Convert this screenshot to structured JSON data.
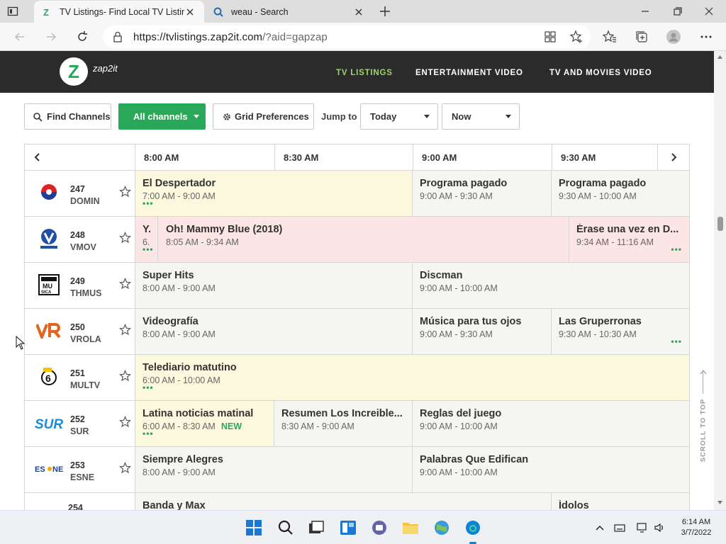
{
  "browser": {
    "tabs": [
      {
        "title": "TV Listings- Find Local TV Listing",
        "active": true
      },
      {
        "title": "weau - Search",
        "active": false
      }
    ],
    "url_host": "https://tvlistings.zap2it.com",
    "url_path": "/?aid=gapzap"
  },
  "site": {
    "logo_letter": "Z",
    "logo_text": "zap2it",
    "nav": [
      {
        "label": "TV LISTINGS",
        "active": true
      },
      {
        "label": "ENTERTAINMENT VIDEO",
        "active": false
      },
      {
        "label": "TV AND MOVIES VIDEO",
        "active": false
      }
    ]
  },
  "controls": {
    "find_channels": "Find Channels",
    "all_channels": "All channels",
    "grid_prefs": "Grid Preferences",
    "jump_to": "Jump to",
    "day": "Today",
    "time": "Now"
  },
  "grid": {
    "times": [
      "8:00 AM",
      "8:30 AM",
      "9:00 AM",
      "9:30 AM"
    ],
    "rows": [
      {
        "num": "247",
        "call": "DOMIN",
        "logo": "domin-logo",
        "programs": [
          {
            "title": "El Despertador",
            "time": "7:00 AM - 9:00 AM",
            "style": "live",
            "dots": "left"
          },
          {
            "title": "Programa pagado",
            "time": "9:00 AM - 9:30 AM",
            "style": "plain"
          },
          {
            "title": "Programa pagado",
            "time": "9:30 AM - 10:00 AM",
            "style": "plain"
          }
        ]
      },
      {
        "num": "248",
        "call": "VMOV",
        "logo": "vmov-logo",
        "programs": [
          {
            "title": "Y.",
            "time": "6.",
            "style": "movie",
            "dots": "left"
          },
          {
            "title": "Oh! Mammy Blue (2018)",
            "time": "8:05 AM - 9:34 AM",
            "style": "movie"
          },
          {
            "title": "Érase una vez en D...",
            "time": "9:34 AM - 11:16 AM",
            "style": "movie",
            "dots": "right"
          }
        ]
      },
      {
        "num": "249",
        "call": "THMUS",
        "logo": "thmus-logo",
        "programs": [
          {
            "title": "Super Hits",
            "time": "8:00 AM - 9:00 AM",
            "style": "plain"
          },
          {
            "title": "Discman",
            "time": "9:00 AM - 10:00 AM",
            "style": "plain"
          }
        ]
      },
      {
        "num": "250",
        "call": "VROLA",
        "logo": "vrola-logo",
        "programs": [
          {
            "title": "Videografía",
            "time": "8:00 AM - 9:00 AM",
            "style": "plain"
          },
          {
            "title": "Música para tus ojos",
            "time": "9:00 AM - 9:30 AM",
            "style": "plain"
          },
          {
            "title": "Las Gruperronas",
            "time": "9:30 AM - 10:30 AM",
            "style": "plain",
            "dots": "right"
          }
        ]
      },
      {
        "num": "251",
        "call": "MULTV",
        "logo": "multv-logo",
        "programs": [
          {
            "title": "Telediario matutino",
            "time": "6:00 AM - 10:00 AM",
            "style": "live",
            "dots": "left"
          }
        ]
      },
      {
        "num": "252",
        "call": "SUR",
        "logo": "sur-logo",
        "programs": [
          {
            "title": "Latina noticias matinal",
            "time": "6:00 AM - 8:30 AM",
            "badge": "NEW",
            "style": "live",
            "dots": "left"
          },
          {
            "title": "Resumen Los Increible...",
            "time": "8:30 AM - 9:00 AM",
            "style": "plain"
          },
          {
            "title": "Reglas del juego",
            "time": "9:00 AM - 10:00 AM",
            "style": "plain"
          }
        ]
      },
      {
        "num": "253",
        "call": "ESNE",
        "logo": "esne-logo",
        "programs": [
          {
            "title": "Siempre Alegres",
            "time": "8:00 AM - 9:00 AM",
            "style": "plain"
          },
          {
            "title": "Palabras Que Edifican",
            "time": "9:00 AM - 10:00 AM",
            "style": "plain"
          }
        ]
      },
      {
        "num": "254",
        "call": "",
        "logo": "bandamax-logo",
        "programs": [
          {
            "title": "Banda y Max",
            "time": "",
            "style": "plain"
          },
          {
            "title": "Ídolos",
            "time": "",
            "style": "plain"
          }
        ]
      }
    ]
  },
  "scroll_to_top": "SCROLL TO TOP",
  "taskbar": {
    "time": "6:14 AM",
    "date": "3/7/2022"
  },
  "colors": {
    "accent_green": "#2aa85a",
    "nav_active": "#9fd46b",
    "header_bg": "#2b2b2b"
  }
}
